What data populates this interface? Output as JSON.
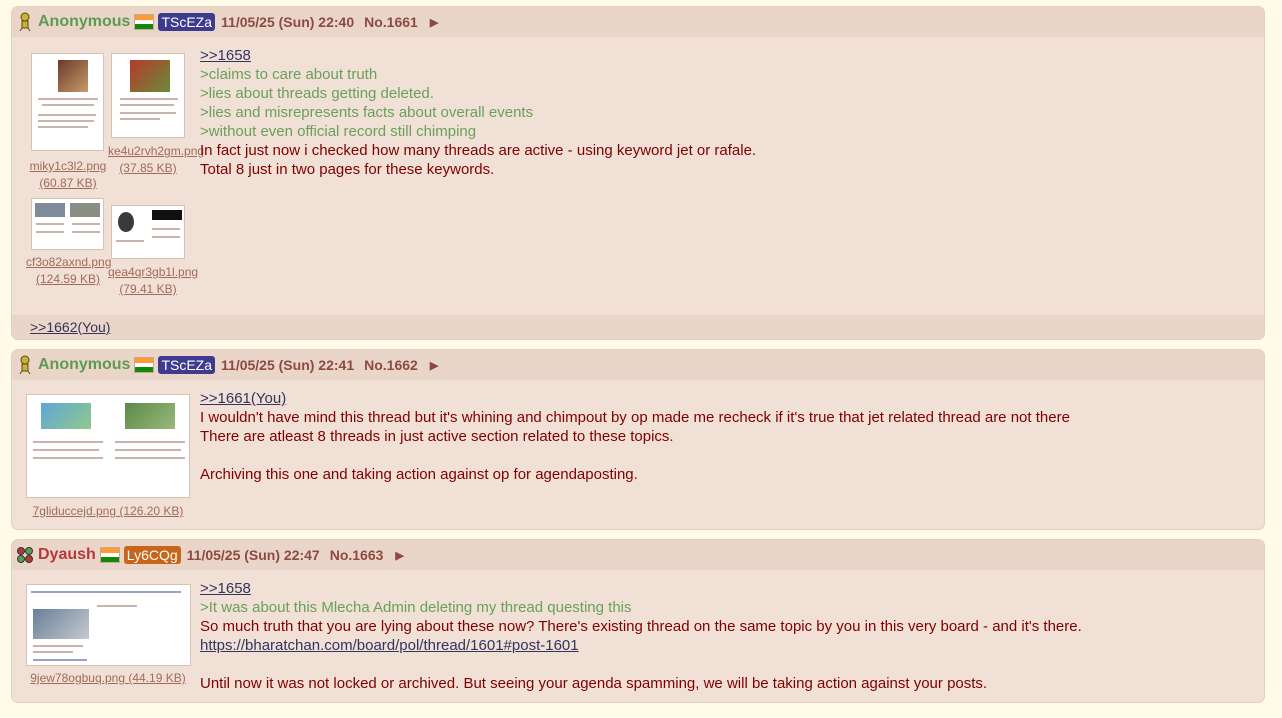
{
  "posts": [
    {
      "name": "Anonymous",
      "uid": "TScEZa",
      "uid_color": "#3d3a8f",
      "date": "11/05/25 (Sun) 22:40",
      "no": "No.1661",
      "files": [
        {
          "name": "miky1c3l2.png",
          "size": "(60.87 KB)"
        },
        {
          "name": "ke4u2rvh2gm.png",
          "size": "(37.85 KB)"
        },
        {
          "name": "cf3o82axnd.png",
          "size": "(124.59 KB)"
        },
        {
          "name": "qea4qr3gb1l.png",
          "size": "(79.41 KB)"
        }
      ],
      "lines": [
        ">>1658",
        ">claims to care about truth",
        ">lies about threads getting deleted.",
        ">lies and misrepresents facts about overall events",
        ">without even official record still chimping",
        "In fact just now i checked how many threads are active - using keyword jet or rafale.",
        "Total 8 just in two pages for these keywords."
      ],
      "replies": ">>1662(You)"
    },
    {
      "name": "Anonymous",
      "uid": "TScEZa",
      "uid_color": "#3d3a8f",
      "date": "11/05/25 (Sun) 22:41",
      "no": "No.1662",
      "files": [
        {
          "name": "7gliduccejd.png",
          "size": "(126.20 KB)"
        }
      ],
      "lines": [
        ">>1661(You)",
        "I wouldn't have mind this thread but it's whining and chimpout by op made me recheck if it's true that jet related thread are not there",
        "There are atleast 8 threads in just active section related to these topics.",
        "",
        "Archiving this one and taking action against op for agendaposting."
      ]
    },
    {
      "name": "Dyaush",
      "uid": "Ly6CQg",
      "uid_color": "#c7651a",
      "date": "11/05/25 (Sun) 22:47",
      "no": "No.1663",
      "files": [
        {
          "name": "9jew78ogbuq.png",
          "size": "(44.19 KB)"
        }
      ],
      "lines": [
        ">>1658",
        ">It was about this Mlecha Admin deleting my thread questing this",
        "So much truth that you are lying about these now? There's existing thread on the same topic by you in this very board - and it's there.",
        "https://bharatchan.com/board/pol/thread/1601#post-1601",
        "",
        "Until now it was not locked or archived. But seeing your agenda spamming, we will be taking action against your posts."
      ]
    }
  ],
  "flag_colors": [
    "#ff9933",
    "#ffffff",
    "#138808"
  ],
  "arrow_glyph": "▶"
}
